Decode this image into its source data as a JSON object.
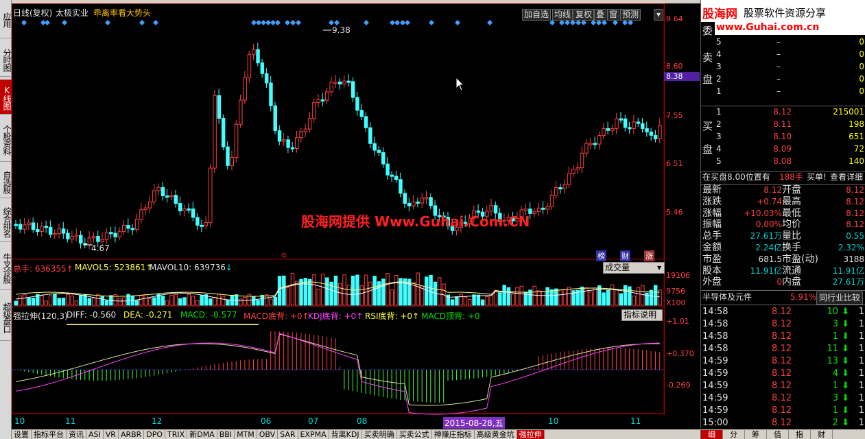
{
  "sidebar": [
    {
      "label": "应用",
      "active": false
    },
    {
      "label": "分时图",
      "active": false
    },
    {
      "label": "K线图",
      "active": true
    },
    {
      "label": "个股资料",
      "active": false
    },
    {
      "label": "自选股",
      "active": false
    },
    {
      "label": "综合排名",
      "active": false
    },
    {
      "label": "牛叉诊股",
      "active": false
    },
    {
      "label": "超级盘口",
      "active": false
    }
  ],
  "main": {
    "title_period": "日线(复权)",
    "stock_name": "太极实业",
    "indicator_label": "乖离率看大势头",
    "buttons": [
      "加自选",
      "均线",
      "复权",
      "叠",
      "窗",
      "预测"
    ],
    "high_label": "9.38",
    "low_label": "4.67",
    "watermark": "股海网提供 Www.Guhai.Com.CN",
    "q_mark": "q",
    "marks": [
      "榜",
      "财",
      "涨"
    ],
    "price_axis": [
      "9.64",
      "8.60",
      "8.38",
      "7.55",
      "6.51",
      "5.46"
    ]
  },
  "volume": {
    "total": "总手: 636355",
    "mavol5": "MAVOL5: 523861",
    "mavol10": "MAVOL10: 639736",
    "button": "成交量",
    "axis": [
      "19106",
      "9756",
      "X100"
    ]
  },
  "macd": {
    "name": "强拉伸(120,3)",
    "diff": "DIFF: -0.560",
    "dea": "DEA: -0.271",
    "macd": "MACD: -0.577",
    "macd_div": "MACD底背: +0",
    "kdj_div": "KDJ底背: +0",
    "rsi_div": "RSI底背: +0",
    "macd_top": "MACD顶背: +0",
    "button": "指标说明",
    "axis": [
      "+1.01",
      "+0.370",
      "-0.269"
    ]
  },
  "xaxis": {
    "labels": [
      "10",
      "11",
      "12",
      "06",
      "07",
      "08",
      "10",
      "11"
    ],
    "cursor_date": "2015-08-28,五"
  },
  "bottom_tabs": [
    "设置",
    "指标平台",
    "资讯",
    "ASI",
    "VR",
    "ARBR",
    "DPO",
    "TRIX",
    "新DMA",
    "BBI",
    "MTM",
    "OBV",
    "SAR",
    "EXPMA",
    "背离KDJ",
    "买卖明确",
    "买卖公式",
    "神赚庄指标",
    "高级黄金坑",
    "强拉伸"
  ],
  "brand": {
    "logo": "股海网",
    "tagline": "股票软件资源分享",
    "url": "www.Guhai.com.cn"
  },
  "orderbook": {
    "wei_label": "委",
    "sell_label": [
      "卖",
      "盘"
    ],
    "buy_label": [
      "买",
      "盘"
    ],
    "sell": [
      {
        "level": "5",
        "price": "–",
        "vol": "0"
      },
      {
        "level": "4",
        "price": "–",
        "vol": "0"
      },
      {
        "level": "3",
        "price": "–",
        "vol": "0"
      },
      {
        "level": "2",
        "price": "–",
        "vol": "0"
      },
      {
        "level": "1",
        "price": "–",
        "vol": "0"
      }
    ],
    "buy": [
      {
        "level": "1",
        "price": "8.12",
        "vol": "215001"
      },
      {
        "level": "2",
        "price": "8.11",
        "vol": "198"
      },
      {
        "level": "3",
        "price": "8.10",
        "vol": "651"
      },
      {
        "level": "4",
        "price": "8.09",
        "vol": "72"
      },
      {
        "level": "5",
        "price": "8.08",
        "vol": "140"
      }
    ]
  },
  "notice": {
    "text": "在买盘8.00位置有",
    "vol": "188手",
    "action": "买单!",
    "detail": "查看详细"
  },
  "quote": [
    {
      "k1": "最新",
      "v1": "8.12",
      "k2": "开盘",
      "v2": "8.12"
    },
    {
      "k1": "涨跌",
      "v1": "+0.74",
      "k2": "最高",
      "v2": "8.12"
    },
    {
      "k1": "涨幅",
      "v1": "+10.03%",
      "k2": "最低",
      "v2": "8.12"
    },
    {
      "k1": "振幅",
      "v1": "0.00%",
      "k2": "均价",
      "v2": "8.12"
    },
    {
      "k1": "总手",
      "v1": "27.61万",
      "k2": "量比",
      "v2": "0.55"
    },
    {
      "k1": "金额",
      "v1": "2.24亿",
      "k2": "换手",
      "v2": "2.32%"
    },
    {
      "k1": "市盈",
      "v1": "681.5",
      "k2": "市盈(动)",
      "v2": "3188"
    },
    {
      "k1": "股本",
      "v1": "11.91亿",
      "k2": "流通",
      "v2": "11.91亿"
    },
    {
      "k1": "外盘",
      "v1": "0",
      "k2": "内盘",
      "v2": "27.61万"
    }
  ],
  "industry": {
    "name": "半导体及元件",
    "change": "5.91%",
    "compare": "同行业比较"
  },
  "ticks": [
    {
      "time": "14:58",
      "price": "8.12",
      "vol": "10",
      "n": "1"
    },
    {
      "time": "14:58",
      "price": "8.12",
      "vol": "3",
      "n": "1"
    },
    {
      "time": "14:58",
      "price": "8.12",
      "vol": "1",
      "n": "1"
    },
    {
      "time": "14:58",
      "price": "8.12",
      "vol": "11",
      "n": "1"
    },
    {
      "time": "14:59",
      "price": "8.12",
      "vol": "13",
      "n": "1"
    },
    {
      "time": "14:59",
      "price": "8.12",
      "vol": "4",
      "n": "1"
    },
    {
      "time": "14:59",
      "price": "8.12",
      "vol": "1",
      "n": "1"
    },
    {
      "time": "14:59",
      "price": "8.12",
      "vol": "3",
      "n": "1"
    },
    {
      "time": "14:59",
      "price": "8.12",
      "vol": "1",
      "n": "1"
    },
    {
      "time": "15:00",
      "price": "8.12",
      "vol": "2",
      "n": "1"
    }
  ],
  "right_tabs": [
    "细",
    "分",
    "筹",
    "值",
    "指",
    "财"
  ]
}
